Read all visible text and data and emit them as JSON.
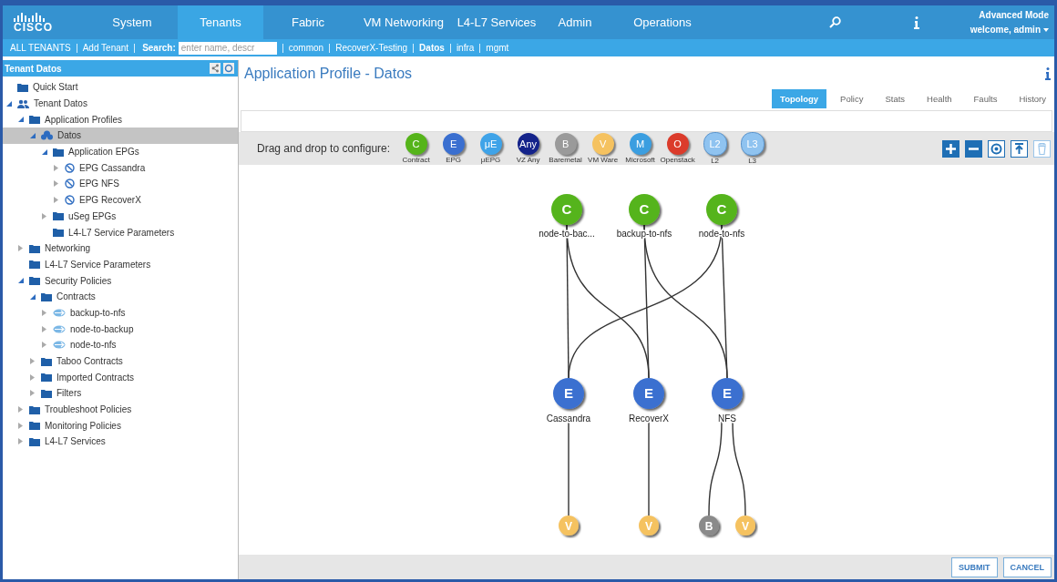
{
  "header": {
    "logo": "CISCO",
    "tabs": [
      {
        "label": "System",
        "selected": false
      },
      {
        "label": "Tenants",
        "selected": true
      },
      {
        "label": "Fabric",
        "selected": false
      },
      {
        "label": "VM Networking",
        "selected": false
      },
      {
        "label": "L4-L7 Services",
        "selected": false
      },
      {
        "label": "Admin",
        "selected": false
      },
      {
        "label": "Operations",
        "selected": false
      }
    ],
    "mode": "Advanced Mode",
    "user": "welcome, admin"
  },
  "subbar": {
    "links": [
      "ALL TENANTS",
      "Add Tenant"
    ],
    "search": {
      "label": "Search:",
      "placeholder": "enter name, descr"
    },
    "tenants": [
      {
        "label": "common",
        "selected": false
      },
      {
        "label": "RecoverX-Testing",
        "selected": false
      },
      {
        "label": "Datos",
        "selected": true
      },
      {
        "label": "infra",
        "selected": false
      },
      {
        "label": "mgmt",
        "selected": false
      }
    ]
  },
  "sidebar": {
    "title": "Tenant Datos",
    "tree": [
      {
        "label": "Quick Start",
        "kind": "folder",
        "selected": false
      },
      {
        "label": "Tenant Datos",
        "kind": "tenant",
        "expanded": true,
        "selected": false,
        "children": [
          {
            "label": "Application Profiles",
            "kind": "folder",
            "expanded": true,
            "selected": false,
            "children": [
              {
                "label": "Datos",
                "kind": "profile",
                "expanded": true,
                "selected": true,
                "children": [
                  {
                    "label": "Application EPGs",
                    "kind": "folder",
                    "expanded": true,
                    "selected": false,
                    "children": [
                      {
                        "label": "EPG Cassandra",
                        "kind": "epg",
                        "expanded": false,
                        "selected": false
                      },
                      {
                        "label": "EPG NFS",
                        "kind": "epg",
                        "expanded": false,
                        "selected": false
                      },
                      {
                        "label": "EPG RecoverX",
                        "kind": "epg",
                        "expanded": false,
                        "selected": false
                      }
                    ]
                  },
                  {
                    "label": "uSeg EPGs",
                    "kind": "folder",
                    "expanded": false,
                    "selected": false
                  },
                  {
                    "label": "L4-L7 Service Parameters",
                    "kind": "folder",
                    "selected": false
                  }
                ]
              }
            ]
          },
          {
            "label": "Networking",
            "kind": "folder",
            "expanded": false,
            "selected": false
          },
          {
            "label": "L4-L7 Service Parameters",
            "kind": "folder",
            "selected": false
          },
          {
            "label": "Security Policies",
            "kind": "folder",
            "expanded": true,
            "selected": false,
            "children": [
              {
                "label": "Contracts",
                "kind": "folder",
                "expanded": true,
                "selected": false,
                "children": [
                  {
                    "label": "backup-to-nfs",
                    "kind": "contract",
                    "expanded": false,
                    "selected": false
                  },
                  {
                    "label": "node-to-backup",
                    "kind": "contract",
                    "expanded": false,
                    "selected": false
                  },
                  {
                    "label": "node-to-nfs",
                    "kind": "contract",
                    "expanded": false,
                    "selected": false
                  }
                ]
              },
              {
                "label": "Taboo Contracts",
                "kind": "folder",
                "expanded": false,
                "selected": false
              },
              {
                "label": "Imported Contracts",
                "kind": "folder",
                "expanded": false,
                "selected": false
              },
              {
                "label": "Filters",
                "kind": "folder",
                "expanded": false,
                "selected": false
              }
            ]
          },
          {
            "label": "Troubleshoot Policies",
            "kind": "folder",
            "expanded": false,
            "selected": false
          },
          {
            "label": "Monitoring Policies",
            "kind": "folder",
            "expanded": false,
            "selected": false
          },
          {
            "label": "L4-L7 Services",
            "kind": "folder",
            "expanded": false,
            "selected": false
          }
        ]
      }
    ]
  },
  "main": {
    "title": "Application Profile - Datos",
    "tabs": [
      {
        "label": "Topology",
        "selected": true
      },
      {
        "label": "Policy",
        "selected": false
      },
      {
        "label": "Stats",
        "selected": false
      },
      {
        "label": "Health",
        "selected": false
      },
      {
        "label": "Faults",
        "selected": false
      },
      {
        "label": "History",
        "selected": false
      }
    ],
    "palette": {
      "label": "Drag and drop to configure:",
      "items": [
        {
          "letter": "C",
          "caption": "Contract",
          "kind": "circle",
          "color": "#55b41a"
        },
        {
          "letter": "E",
          "caption": "EPG",
          "kind": "circle",
          "color": "#3a6fd0"
        },
        {
          "letter": "μE",
          "caption": "μEPG",
          "kind": "circle",
          "color": "#3fa3e8"
        },
        {
          "letter": "Any",
          "caption": "VZ Any",
          "kind": "circle",
          "color": "#14238a"
        },
        {
          "letter": "B",
          "caption": "Baremetal",
          "kind": "circle",
          "color": "#9a9a9a"
        },
        {
          "letter": "V",
          "caption": "VM Ware",
          "kind": "circle",
          "color": "#f5c260"
        },
        {
          "letter": "M",
          "caption": "Microsoft",
          "kind": "circle",
          "color": "#3b9ee0"
        },
        {
          "letter": "O",
          "caption": "Openstack",
          "kind": "circle",
          "color": "#db3b2b"
        },
        {
          "letter": "L2",
          "caption": "L2",
          "kind": "cloud",
          "color": "#8fc3f0"
        },
        {
          "letter": "L3",
          "caption": "L3",
          "kind": "cloud",
          "color": "#8fc3f0"
        }
      ]
    },
    "topology": {
      "contracts": [
        {
          "letter": "C",
          "label": "node-to-bac..."
        },
        {
          "letter": "C",
          "label": "backup-to-nfs"
        },
        {
          "letter": "C",
          "label": "node-to-nfs"
        }
      ],
      "epgs": [
        {
          "letter": "E",
          "label": "Cassandra",
          "links": [
            {
              "kind": "up"
            },
            {
              "kind": "up-right-2"
            }
          ],
          "endpoints": [
            {
              "kind": "vmware",
              "letter": "V"
            }
          ]
        },
        {
          "letter": "E",
          "label": "RecoverX",
          "links": [
            {
              "kind": "up-left"
            },
            {
              "kind": "up"
            }
          ],
          "endpoints": [
            {
              "kind": "vmware",
              "letter": "V"
            }
          ]
        },
        {
          "letter": "E",
          "label": "NFS",
          "links": [
            {
              "kind": "up-left"
            },
            {
              "kind": "up"
            }
          ],
          "endpoints": [
            {
              "kind": "baremetal",
              "letter": "B"
            },
            {
              "kind": "vmware",
              "letter": "V"
            }
          ]
        }
      ]
    },
    "buttons": [
      "SUBMIT",
      "CANCEL"
    ]
  }
}
